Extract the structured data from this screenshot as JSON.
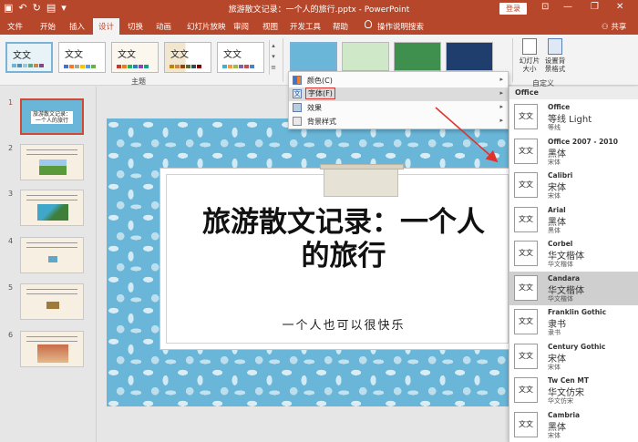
{
  "titlebar": {
    "title": "旅游散文记录：一个人的旅行.pptx  -  PowerPoint",
    "login": "登录",
    "minimize": "—",
    "restore": "❐",
    "close": "✕"
  },
  "tabs": {
    "file": "文件",
    "home": "开始",
    "insert": "插入",
    "design": "设计",
    "transitions": "切换",
    "animations": "动画",
    "slideshow": "幻灯片放映",
    "review": "审阅",
    "view": "视图",
    "developer": "开发工具",
    "help": "帮助",
    "tell_me": "操作说明搜索",
    "share": "共享"
  },
  "ribbon": {
    "themes_label": "主题",
    "theme_samples": [
      "文文",
      "文文",
      "文文",
      "文文",
      "文文"
    ],
    "slide_size": "幻灯片\n大小",
    "format_bg": "设置背\n景格式",
    "customize_label": "自定义"
  },
  "variant_menu": {
    "colors": "颜色(C)",
    "fonts": "字体(F)",
    "effects": "效果",
    "bg_styles": "背景样式"
  },
  "slides": {
    "numbers": [
      "1",
      "2",
      "3",
      "4",
      "5",
      "6"
    ],
    "thumb1_title": "旅游散文记录：一个人的旅行"
  },
  "slide": {
    "title_line1": "旅游散文记录：一个人",
    "title_line2": "的旅行",
    "subtitle": "一个人也可以很快乐"
  },
  "font_panel": {
    "header": "Office",
    "sample": "文文",
    "items": [
      {
        "name": "Office",
        "heading": "等线 Light",
        "body": "等线"
      },
      {
        "name": "Office 2007 - 2010",
        "heading": "黑体",
        "body": "宋体"
      },
      {
        "name": "Calibri",
        "heading": "宋体",
        "body": "宋体"
      },
      {
        "name": "Arial",
        "heading": "黑体",
        "body": "黑体"
      },
      {
        "name": "Corbel",
        "heading": "华文楷体",
        "body": "华文楷体"
      },
      {
        "name": "Candara",
        "heading": "华文楷体",
        "body": "华文楷体"
      },
      {
        "name": "Franklin Gothic",
        "heading": "隶书",
        "body": "隶书"
      },
      {
        "name": "Century Gothic",
        "heading": "宋体",
        "body": "宋体"
      },
      {
        "name": "Tw Cen MT",
        "heading": "华文仿宋",
        "body": "华文仿宋"
      },
      {
        "name": "Cambria",
        "heading": "黑体",
        "body": "宋体"
      }
    ]
  },
  "colors": {
    "accent": "#b7472a",
    "slide_bg": "#6ab6d8",
    "highlight": "#e0322a"
  }
}
